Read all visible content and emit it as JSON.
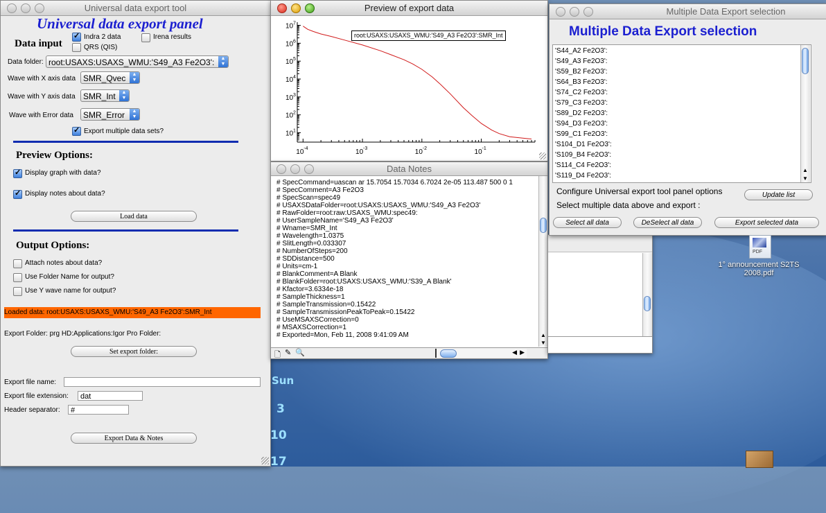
{
  "panel": {
    "title": "Universal data export tool",
    "heading": "Universal data export panel",
    "data_input_label": "Data input",
    "chk_indra": "Indra 2 data",
    "chk_irena": "Irena results",
    "chk_qrs": "QRS (QIS)",
    "data_folder_label": "Data folder:",
    "data_folder_value": "root:USAXS:USAXS_WMU:'S49_A3 Fe2O3':",
    "x_label": "Wave with X axis data",
    "x_value": "SMR_Qvec",
    "y_label": "Wave with Y axis data",
    "y_value": "SMR_Int",
    "err_label": "Wave with Error data",
    "err_value": "SMR_Error",
    "export_multiple": "Export multiple data sets?",
    "preview_options": "Preview Options:",
    "display_graph": "Display graph with data?",
    "display_notes": "Display notes about data?",
    "load_data": "Load data",
    "output_options": "Output Options:",
    "attach_notes": "Attach notes about data?",
    "use_folder": "Use Folder Name for output?",
    "use_y": "Use Y wave name for output?",
    "loaded_data": "Loaded data:  root:USAXS:USAXS_WMU:'S49_A3 Fe2O3':SMR_Int",
    "export_folder": "Export Folder:   prg HD:Applications:Igor Pro Folder:",
    "set_export_folder": "Set export  folder:",
    "export_file_name_label": "Export file name:",
    "export_file_name_value": "",
    "ext_label": "Export file extension:",
    "ext_value": "dat",
    "sep_label": "Header separator:",
    "sep_value": "#",
    "export_button": "Export Data & Notes"
  },
  "preview": {
    "title": "Preview of export data",
    "legend": "root:USAXS:USAXS_WMU:'S49_A3 Fe2O3':SMR_Int",
    "y_ticks": [
      "10",
      "10",
      "10",
      "10",
      "10",
      "10",
      "10"
    ],
    "y_exps": [
      "7",
      "6",
      "5",
      "4",
      "3",
      "2",
      "1"
    ],
    "x_ticks": [
      "10",
      "10",
      "10",
      "10"
    ],
    "x_exps": [
      "-4",
      "-3",
      "-2",
      "-1"
    ]
  },
  "chart_data": {
    "type": "line",
    "title": "",
    "xlabel": "",
    "ylabel": "",
    "x_scale": "log",
    "y_scale": "log",
    "xlim": [
      8e-05,
      0.8
    ],
    "ylim": [
      3,
      15000000
    ],
    "grid": false,
    "legend_placement": "top-right",
    "series": [
      {
        "name": "root:USAXS:USAXS_WMU:'S49_A3 Fe2O3':SMR_Int",
        "color": "#d11a1a",
        "x": [
          0.0001,
          0.00012,
          0.00015,
          0.0002,
          0.0003,
          0.0005,
          0.001,
          0.002,
          0.003,
          0.005,
          0.007,
          0.01,
          0.015,
          0.02,
          0.03,
          0.05,
          0.07,
          0.1,
          0.15,
          0.2,
          0.3,
          0.5,
          0.7
        ],
        "y": [
          9000000,
          6000000,
          4500000,
          3300000,
          2400000,
          1500000,
          800000,
          380000,
          230000,
          120000,
          70000,
          35000,
          13000,
          5500,
          1500,
          250,
          90,
          33,
          14,
          9,
          6,
          5,
          4.5
        ]
      }
    ]
  },
  "notes": {
    "title": "Data Notes",
    "lines": [
      "#    SpecCommand=uascan  ar 15.7054 15.7034 6.7024 2e-05  113.487 500 0 1",
      "#    SpecComment=A3 Fe2O3",
      "#    SpecScan=spec49",
      "#    USAXSDataFolder=root:USAXS:USAXS_WMU:'S49_A3 Fe2O3'",
      "#    RawFolder=root:raw:USAXS_WMU:spec49:",
      "#    UserSampleName='S49_A3 Fe2O3'",
      "#    Wname=SMR_Int",
      "#    Wavelength=1.0375",
      "#    SlitLength=0.033307",
      "#    NumberOfSteps=200",
      "#    SDDistance=500",
      "#    Units=cm-1",
      "#    BlankComment=A Blank",
      "#    BlankFolder=root:USAXS:USAXS_WMU:'S39_A Blank'",
      "#    Kfactor=3.6334e-18",
      "#    SampleThickness=1",
      "#    SampleTransmission=0.15422",
      "#    SampleTransmissionPeakToPeak=0.15422",
      "#    UseMSAXSCorrection=0",
      "#    MSAXSCorrection=1",
      "#    Exported=Mon, Feb 11, 2008 9:41:09 AM"
    ]
  },
  "multi": {
    "title": "Multiple Data Export selection",
    "heading": "Multiple Data Export selection",
    "items": [
      "'S44_A2 Fe2O3':",
      "'S49_A3 Fe2O3':",
      "'S59_B2 Fe2O3':",
      "'S64_B3 Fe2O3':",
      "'S74_C2 Fe2O3':",
      "'S79_C3 Fe2O3':",
      "'S89_D2 Fe2O3':",
      "'S94_D3 Fe2O3':",
      "'S99_C1 Fe2O3':",
      "'S104_D1 Fe2O3':",
      "'S109_B4 Fe2O3':",
      "'S114_C4 Fe2O3':",
      "'S119_D4 Fe2O3':"
    ],
    "configure_text": "Configure Universal export tool panel options",
    "update_list": "Update list",
    "select_text": "Select multiple data above and export :",
    "select_all": "Select all data",
    "deselect_all": "DeSelect all data",
    "export_selected": "Export selected data"
  },
  "desktop": {
    "file_label": "1° announcement S2TS 2008.pdf",
    "pdf_badge": "PDF",
    "cal_day": "Sun",
    "cal_nums": [
      "3",
      "10",
      "17"
    ]
  }
}
